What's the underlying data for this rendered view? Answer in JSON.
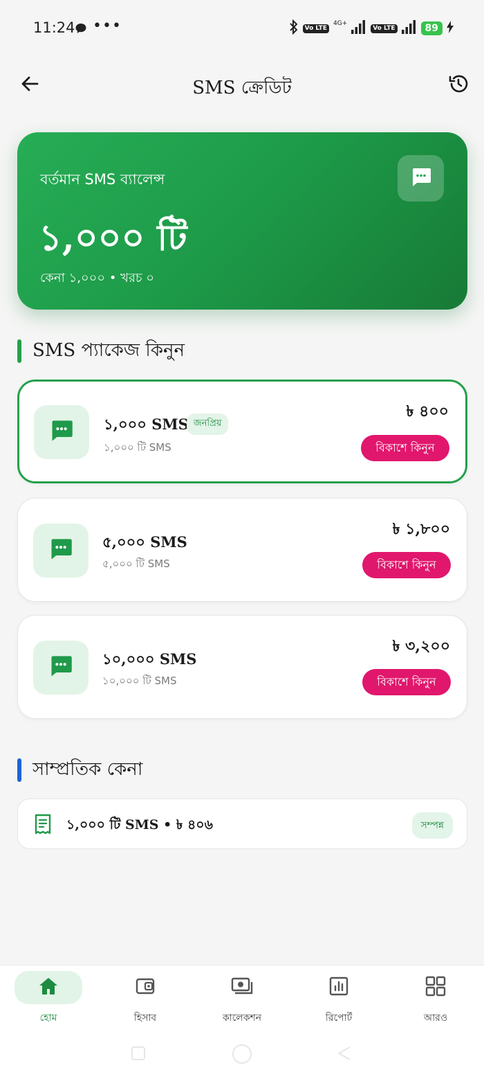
{
  "status_bar": {
    "time": "11:24",
    "dots": "•••",
    "network_label": "4G+",
    "volte_label": "Vo LTE",
    "battery": "89"
  },
  "app_bar": {
    "title": "SMS ক্রেডিট",
    "back_icon": "arrow-left-icon",
    "history_icon": "history-icon"
  },
  "balance": {
    "label": "বর্তমান SMS ব্যালেন্স",
    "value": "১,০০০ টি",
    "sub": "কেনা ১,০০০ • খরচ ০"
  },
  "packages_section": {
    "title": "SMS প্যাকেজ কিনুন",
    "items": [
      {
        "name": "১,০০০ SMS",
        "badge": "জনপ্রিয়",
        "sub": "১,০০০ টি SMS",
        "price": "৳ ৪০০",
        "buy_label": "বিকাশে কিনুন",
        "selected": true
      },
      {
        "name": "৫,০০০ SMS",
        "badge": "",
        "sub": "৫,০০০ টি SMS",
        "price": "৳ ১,৮০০",
        "buy_label": "বিকাশে কিনুন",
        "selected": false
      },
      {
        "name": "১০,০০০ SMS",
        "badge": "",
        "sub": "১০,০০০ টি SMS",
        "price": "৳ ৩,২০০",
        "buy_label": "বিকাশে কিনুন",
        "selected": false
      }
    ]
  },
  "recent_section": {
    "title": "সাম্প্রতিক কেনা",
    "items": [
      {
        "text": "১,০০০ টি SMS • ৳ ৪০৬",
        "status": "সম্পন্ন"
      }
    ]
  },
  "bottom_nav": {
    "items": [
      {
        "label": "হোম",
        "icon": "home-icon",
        "active": true
      },
      {
        "label": "হিসাব",
        "icon": "wallet-icon",
        "active": false
      },
      {
        "label": "কালেকশন",
        "icon": "cash-icon",
        "active": false
      },
      {
        "label": "রিপোর্ট",
        "icon": "bar-chart-icon",
        "active": false
      },
      {
        "label": "আরও",
        "icon": "grid-icon",
        "active": false
      }
    ]
  },
  "colors": {
    "primary_green": "#1d9a48",
    "accent_pink": "#e0176d",
    "blue_accent": "#1d64d8"
  }
}
